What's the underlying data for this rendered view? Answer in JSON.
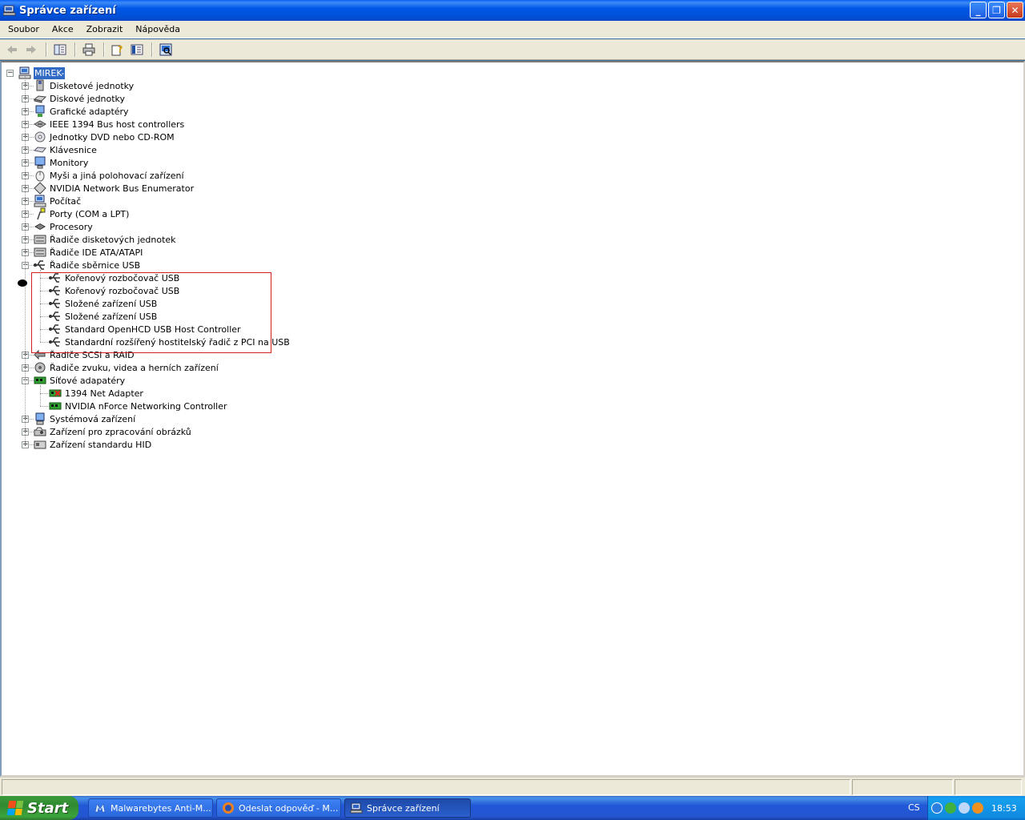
{
  "window": {
    "title": "Správce zařízení"
  },
  "menu": [
    "Soubor",
    "Akce",
    "Zobrazit",
    "Nápověda"
  ],
  "toolbar": {
    "buttons": [
      "back-icon",
      "forward-icon",
      "show-hide-tree-icon",
      "print-icon",
      "help-icon",
      "properties-icon",
      "scan-hardware-icon"
    ]
  },
  "tree": {
    "root": "MIREK-",
    "categories": [
      {
        "label": "Disketové jednotky",
        "icon": "floppy-drive-icon",
        "expanded": false
      },
      {
        "label": "Diskové jednotky",
        "icon": "disk-drive-icon",
        "expanded": false
      },
      {
        "label": "Grafické adaptéry",
        "icon": "display-adapter-icon",
        "expanded": false
      },
      {
        "label": "IEEE 1394 Bus host controllers",
        "icon": "ieee1394-icon",
        "expanded": false
      },
      {
        "label": "Jednotky DVD nebo CD-ROM",
        "icon": "cdrom-icon",
        "expanded": false
      },
      {
        "label": "Klávesnice",
        "icon": "keyboard-icon",
        "expanded": false
      },
      {
        "label": "Monitory",
        "icon": "monitor-icon",
        "expanded": false
      },
      {
        "label": "Myši a jiná polohovací zařízení",
        "icon": "mouse-icon",
        "expanded": false
      },
      {
        "label": "NVIDIA Network Bus Enumerator",
        "icon": "bus-enumerator-icon",
        "expanded": false
      },
      {
        "label": "Počítač",
        "icon": "computer-icon",
        "expanded": false
      },
      {
        "label": "Porty (COM a LPT)",
        "icon": "port-icon",
        "expanded": false
      },
      {
        "label": "Procesory",
        "icon": "processor-icon",
        "expanded": false
      },
      {
        "label": "Řadiče disketových jednotek",
        "icon": "floppy-controller-icon",
        "expanded": false
      },
      {
        "label": "Řadiče IDE ATA/ATAPI",
        "icon": "ide-controller-icon",
        "expanded": false
      },
      {
        "label": "Řadiče sběrnice USB",
        "icon": "usb-icon",
        "expanded": true,
        "children": [
          "Kořenový rozbočovač USB",
          "Kořenový rozbočovač USB",
          "Složené zařízení USB",
          "Složené zařízení USB",
          "Standard OpenHCD USB Host Controller",
          "Standardní rozšířený hostitelský řadič z PCI na USB"
        ]
      },
      {
        "label": "Řadiče SCSI a RAID",
        "icon": "scsi-icon",
        "expanded": false
      },
      {
        "label": "Řadiče zvuku, videa a herních zařízení",
        "icon": "sound-icon",
        "expanded": false
      },
      {
        "label": "Síťové adapatéry",
        "icon": "network-adapter-icon",
        "expanded": true,
        "children": [
          "1394 Net Adapter",
          "NVIDIA nForce Networking Controller"
        ]
      },
      {
        "label": "Systémová zařízení",
        "icon": "system-devices-icon",
        "expanded": false
      },
      {
        "label": "Zařízení pro zpracování obrázků",
        "icon": "imaging-device-icon",
        "expanded": false
      },
      {
        "label": "Zařízení standardu HID",
        "icon": "hid-icon",
        "expanded": false
      }
    ]
  },
  "taskbar": {
    "start_label": "Start",
    "tasks": [
      {
        "label": "Malwarebytes Anti-M...",
        "icon": "malwarebytes-icon",
        "active": false
      },
      {
        "label": "Odeslat odpověď - M...",
        "icon": "firefox-icon",
        "active": false
      },
      {
        "label": "Správce zařízení",
        "icon": "device-manager-icon",
        "active": true
      }
    ],
    "language": "CS",
    "clock": "18:53"
  }
}
